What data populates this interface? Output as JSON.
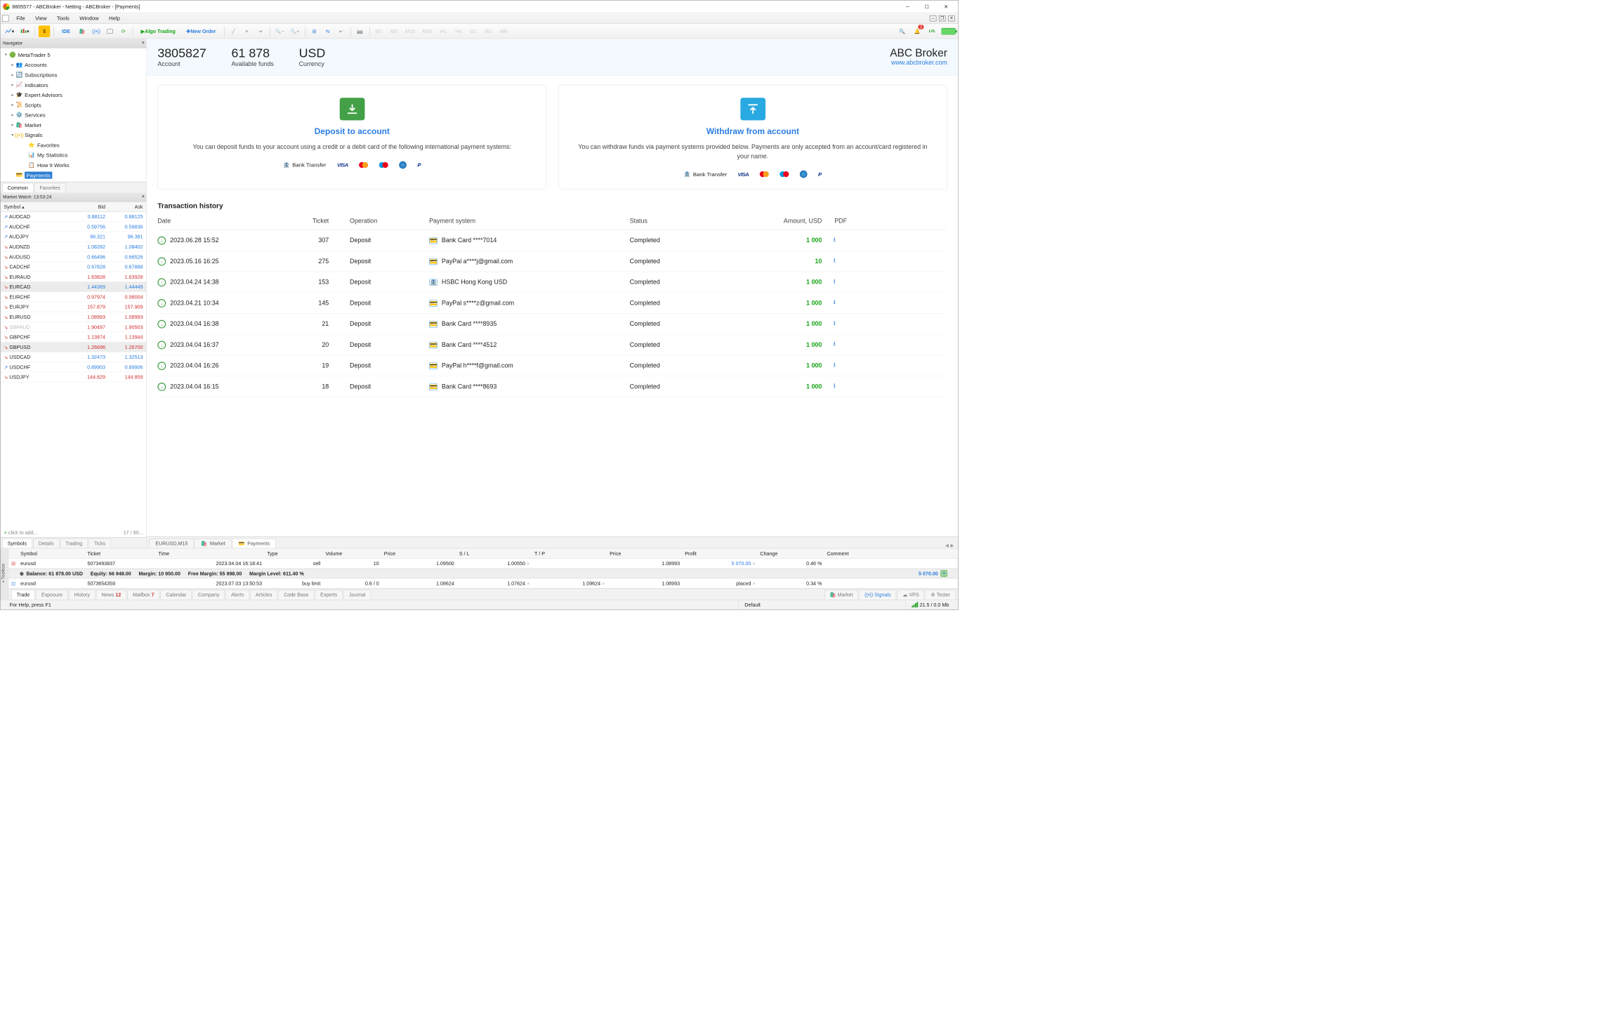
{
  "window": {
    "title": "8805577 - ABCBroker - Netting - ABCBroker - [Payments]"
  },
  "menu": {
    "file": "File",
    "view": "View",
    "tools": "Tools",
    "window": "Window",
    "help": "Help"
  },
  "toolbar": {
    "ide": "IDE",
    "algo": "Algo Trading",
    "neworder": "New Order",
    "timeframes": [
      "M1",
      "M5",
      "M15",
      "M30",
      "H1",
      "H4",
      "D1",
      "W1",
      "MN"
    ],
    "notif_count": "2",
    "lvl": "LVL"
  },
  "navigator": {
    "title": "Navigator",
    "root": "MetaTrader 5",
    "items": [
      "Accounts",
      "Subscriptions",
      "Indicators",
      "Expert Advisors",
      "Scripts",
      "Services",
      "Market",
      "Signals"
    ],
    "signals_children": [
      "Favorites",
      "My Statistics",
      "How It Works"
    ],
    "payments": "Payments",
    "tabs": {
      "common": "Common",
      "favorites": "Favorites"
    }
  },
  "marketwatch": {
    "title": "Market Watch: 13:53:24",
    "cols": {
      "symbol": "Symbol",
      "bid": "Bid",
      "ask": "Ask"
    },
    "rows": [
      {
        "dir": "up",
        "sym": "AUDCAD",
        "bid": "0.88112",
        "ask": "0.88125",
        "c": "blue"
      },
      {
        "dir": "up",
        "sym": "AUDCHF",
        "bid": "0.59756",
        "ask": "0.59836",
        "c": "blue"
      },
      {
        "dir": "up",
        "sym": "AUDJPY",
        "bid": "96.321",
        "ask": "96.381",
        "c": "blue"
      },
      {
        "dir": "dn",
        "sym": "AUDNZD",
        "bid": "1.08282",
        "ask": "1.08402",
        "c": "blue"
      },
      {
        "dir": "dn",
        "sym": "AUDUSD",
        "bid": "0.66496",
        "ask": "0.66526",
        "c": "blue"
      },
      {
        "dir": "dn",
        "sym": "CADCHF",
        "bid": "0.67828",
        "ask": "0.67888",
        "c": "blue"
      },
      {
        "dir": "dn",
        "sym": "EURAUD",
        "bid": "1.63828",
        "ask": "1.63928",
        "c": "red"
      },
      {
        "dir": "dn",
        "sym": "EURCAD",
        "bid": "1.44369",
        "ask": "1.44449",
        "c": "blue",
        "hl": true
      },
      {
        "dir": "dn",
        "sym": "EURCHF",
        "bid": "0.97974",
        "ask": "0.98004",
        "c": "red"
      },
      {
        "dir": "dn",
        "sym": "EURJPY",
        "bid": "157.879",
        "ask": "157.909",
        "c": "red"
      },
      {
        "dir": "dn",
        "sym": "EURUSD",
        "bid": "1.08993",
        "ask": "1.08993",
        "c": "red"
      },
      {
        "dir": "dn",
        "sym": "GBPAUD",
        "bid": "1.90497",
        "ask": "1.90503",
        "c": "red",
        "dim": true
      },
      {
        "dir": "dn",
        "sym": "GBPCHF",
        "bid": "1.13874",
        "ask": "1.13944",
        "c": "red"
      },
      {
        "dir": "dn",
        "sym": "GBPUSD",
        "bid": "1.26696",
        "ask": "1.26700",
        "c": "red",
        "hl": true
      },
      {
        "dir": "dn",
        "sym": "USDCAD",
        "bid": "1.32473",
        "ask": "1.32513",
        "c": "blue"
      },
      {
        "dir": "up",
        "sym": "USDCHF",
        "bid": "0.89903",
        "ask": "0.89906",
        "c": "blue"
      },
      {
        "dir": "dn",
        "sym": "USDJPY",
        "bid": "144.829",
        "ask": "144.859",
        "c": "red"
      }
    ],
    "add": "click to add...",
    "count": "17 / 90...",
    "tabs": {
      "symbols": "Symbols",
      "details": "Details",
      "trading": "Trading",
      "ticks": "Ticks"
    }
  },
  "account": {
    "number": "3805827",
    "number_label": "Account",
    "funds": "61 878",
    "funds_label": "Available funds",
    "currency": "USD",
    "currency_label": "Currency",
    "broker": "ABC Broker",
    "broker_url": "www.abcbroker.com"
  },
  "cards": {
    "deposit": {
      "title": "Deposit to account",
      "desc": "You can deposit funds to your account using a credit or a debit card of the following international payment systems:"
    },
    "withdraw": {
      "title": "Withdraw from account",
      "desc": "You can withdraw funds via payment systems provided below. Payments are only accepted from an account/card registered in your name."
    },
    "bank_transfer": "Bank Transfer"
  },
  "history": {
    "title": "Transaction history",
    "cols": {
      "date": "Date",
      "ticket": "Ticket",
      "op": "Operation",
      "ps": "Payment system",
      "status": "Status",
      "amount": "Amount, USD",
      "pdf": "PDF"
    },
    "rows": [
      {
        "date": "2023.06.28 15:52",
        "ticket": "307",
        "op": "Deposit",
        "ps": "Bank Card ****7014",
        "status": "Completed",
        "amount": "1 000",
        "ico": "card"
      },
      {
        "date": "2023.05.16 16:25",
        "ticket": "275",
        "op": "Deposit",
        "ps": "PayPal a****j@gmail.com",
        "status": "Completed",
        "amount": "10",
        "ico": "card"
      },
      {
        "date": "2023.04.24 14:38",
        "ticket": "153",
        "op": "Deposit",
        "ps": "HSBC Hong Kong USD",
        "status": "Completed",
        "amount": "1 000",
        "ico": "bank"
      },
      {
        "date": "2023.04.21 10:34",
        "ticket": "145",
        "op": "Deposit",
        "ps": "PayPal s****z@gmail.com",
        "status": "Completed",
        "amount": "1 000",
        "ico": "card"
      },
      {
        "date": "2023.04.04 16:38",
        "ticket": "21",
        "op": "Deposit",
        "ps": "Bank Card ****8935",
        "status": "Completed",
        "amount": "1 000",
        "ico": "card"
      },
      {
        "date": "2023.04.04 16:37",
        "ticket": "20",
        "op": "Deposit",
        "ps": "Bank Card ****4512",
        "status": "Completed",
        "amount": "1 000",
        "ico": "card"
      },
      {
        "date": "2023.04.04 16:26",
        "ticket": "19",
        "op": "Deposit",
        "ps": "PayPal h****f@gmail.com",
        "status": "Completed",
        "amount": "1 000",
        "ico": "card"
      },
      {
        "date": "2023.04.04 16:15",
        "ticket": "18",
        "op": "Deposit",
        "ps": "Bank Card ****8693",
        "status": "Completed",
        "amount": "1 000",
        "ico": "card"
      }
    ]
  },
  "doc_tabs": {
    "chart": "EURUSD,M15",
    "market": "Market",
    "payments": "Payments"
  },
  "toolbox": {
    "label": "Toolbox",
    "cols": {
      "symbol": "Symbol",
      "ticket": "Ticket",
      "time": "Time",
      "type": "Type",
      "volume": "Volume",
      "price": "Price",
      "sl": "S / L",
      "tp": "T / P",
      "price2": "Price",
      "profit": "Profit",
      "change": "Change",
      "comment": "Comment"
    },
    "rows": [
      {
        "kind": "pos",
        "symbol": "eurusd",
        "ticket": "5073493837",
        "time": "2023.04.04 16:18:41",
        "type": "sell",
        "volume": "10",
        "price": "1.09500",
        "sl": "1.00550",
        "tp": "",
        "price2": "1.08993",
        "profit": "5 070.00",
        "change": "0.46 %",
        "comment": ""
      },
      {
        "kind": "ord",
        "symbol": "eurusd",
        "ticket": "5073654359",
        "time": "2023.07.03 13:50:53",
        "type": "buy limit",
        "volume": "0.6 / 0",
        "price": "1.08624",
        "sl": "1.07624",
        "tp": "1.09624",
        "price2": "1.08993",
        "profit": "placed",
        "change": "0.34 %",
        "comment": ""
      }
    ],
    "balance": {
      "balance": "Balance: 61 878.00 USD",
      "equity": "Equity: 66 948.00",
      "margin": "Margin: 10 950.00",
      "free": "Free Margin: 55 998.00",
      "level": "Margin Level: 611.40 %",
      "profit": "5 070.00"
    },
    "tabs": [
      "Trade",
      "Exposure",
      "History",
      "News",
      "Mailbox",
      "Calendar",
      "Company",
      "Alerts",
      "Articles",
      "Code Base",
      "Experts",
      "Journal"
    ],
    "news_badge": "12",
    "mail_badge": "7",
    "right": {
      "market": "Market",
      "signals": "Signals",
      "vps": "VPS",
      "tester": "Tester"
    }
  },
  "status": {
    "help": "For Help, press F1",
    "profile": "Default",
    "net": "21.5 / 0.0 Mb"
  }
}
